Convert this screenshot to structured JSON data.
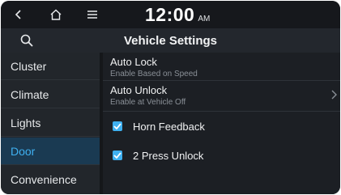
{
  "status_bar": {
    "time": "12:00",
    "ampm": "AM",
    "icons": [
      "back-icon",
      "home-icon",
      "menu-icon"
    ]
  },
  "title_bar": {
    "title": "Vehicle Settings",
    "search_icon": "search-icon"
  },
  "sidebar": {
    "items": [
      {
        "label": "Cluster",
        "active": false
      },
      {
        "label": "Climate",
        "active": false
      },
      {
        "label": "Lights",
        "active": false
      },
      {
        "label": "Door",
        "active": true
      },
      {
        "label": "Convenience",
        "active": false
      }
    ]
  },
  "door_settings": {
    "auto_lock": {
      "title": "Auto Lock",
      "value": "Enable Based on Speed"
    },
    "auto_unlock": {
      "title": "Auto Unlock",
      "value": "Enable at Vehicle Off"
    },
    "horn_feedback": {
      "label": "Horn Feedback",
      "checked": true
    },
    "two_press_unlock": {
      "label": "2 Press Unlock",
      "checked": true
    }
  },
  "colors": {
    "accent": "#3fb0f0",
    "background": "#1c1f24",
    "sidebar_active_bg": "#1a3a52"
  }
}
